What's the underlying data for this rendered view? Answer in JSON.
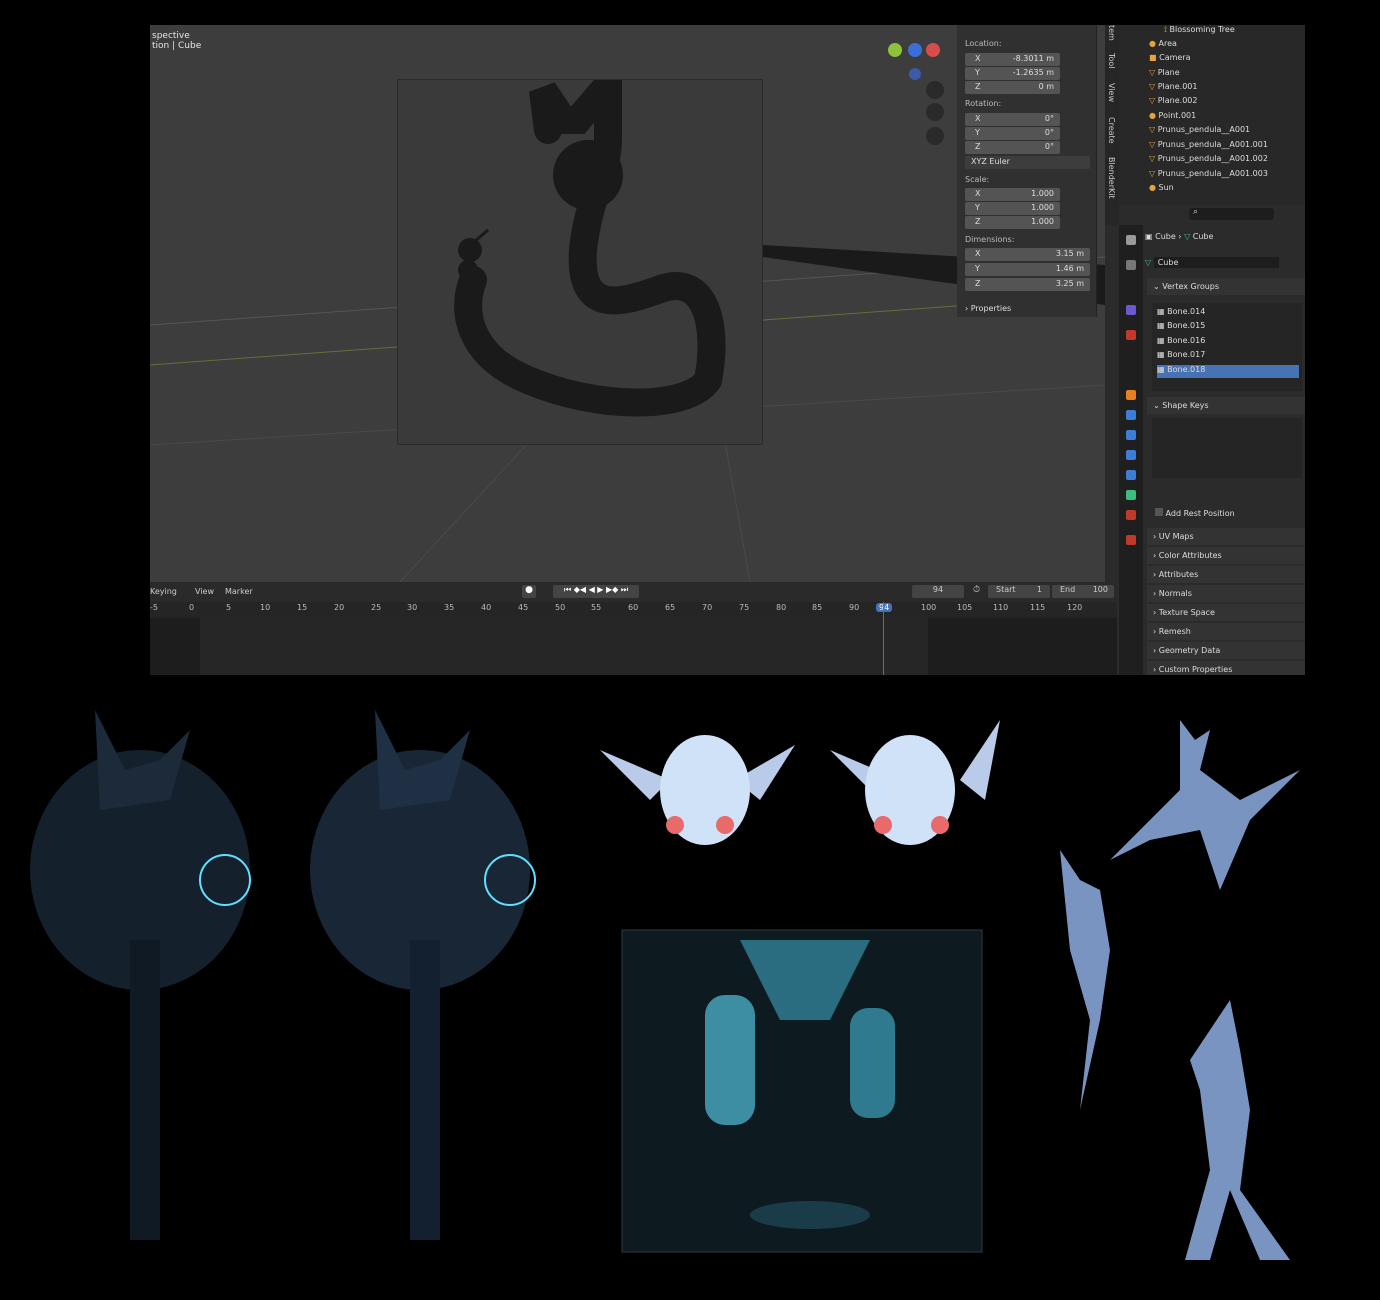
{
  "viewport": {
    "title_line1": "spective",
    "title_line2": "tion | Cube"
  },
  "npanel": {
    "location_label": "Location:",
    "loc": [
      {
        "ax": "X",
        "val": "-8.3011 m"
      },
      {
        "ax": "Y",
        "val": "-1.2635 m"
      },
      {
        "ax": "Z",
        "val": "0 m"
      }
    ],
    "rotation_label": "Rotation:",
    "rot": [
      {
        "ax": "X",
        "val": "0°"
      },
      {
        "ax": "Y",
        "val": "0°"
      },
      {
        "ax": "Z",
        "val": "0°"
      }
    ],
    "euler": "XYZ Euler",
    "scale_label": "Scale:",
    "scale": [
      {
        "ax": "X",
        "val": "1.000"
      },
      {
        "ax": "Y",
        "val": "1.000"
      },
      {
        "ax": "Z",
        "val": "1.000"
      }
    ],
    "dim_label": "Dimensions:",
    "dim": [
      {
        "ax": "X",
        "val": "3.15 m"
      },
      {
        "ax": "Y",
        "val": "1.46 m"
      },
      {
        "ax": "Z",
        "val": "3.25 m"
      }
    ],
    "properties": "Properties"
  },
  "vtabs": [
    "tem",
    "Tool",
    "View",
    "Create",
    "BlenderKit"
  ],
  "outliner": {
    "rows": [
      "Blossoming Tree",
      "Area",
      "Camera",
      "Plane",
      "Plane.001",
      "Plane.002",
      "Point.001",
      "Prunus_pendula__A001",
      "Prunus_pendula__A001.001",
      "Prunus_pendula__A001.002",
      "Prunus_pendula__A001.003",
      "Sun"
    ]
  },
  "props": {
    "crumb1": "Cube",
    "crumb2": "Cube",
    "mesh": "Cube",
    "vertex_groups": "Vertex Groups",
    "vgroups": [
      "Bone.014",
      "Bone.015",
      "Bone.016",
      "Bone.017",
      "Bone.018"
    ],
    "shape_keys": "Shape Keys",
    "add_rest": "Add Rest Position",
    "sections": [
      "UV Maps",
      "Color Attributes",
      "Attributes",
      "Normals",
      "Texture Space",
      "Remesh",
      "Geometry Data",
      "Custom Properties"
    ]
  },
  "timeline": {
    "menu": [
      "Keying",
      "View",
      "Marker"
    ],
    "frame": "94",
    "start_label": "Start",
    "start": "1",
    "end_label": "End",
    "end": "100",
    "ticks": [
      "-5",
      "0",
      "5",
      "10",
      "15",
      "20",
      "25",
      "30",
      "35",
      "40",
      "45",
      "50",
      "55",
      "60",
      "65",
      "70",
      "75",
      "80",
      "85",
      "90",
      "94",
      "100",
      "105",
      "110",
      "115",
      "120"
    ]
  }
}
